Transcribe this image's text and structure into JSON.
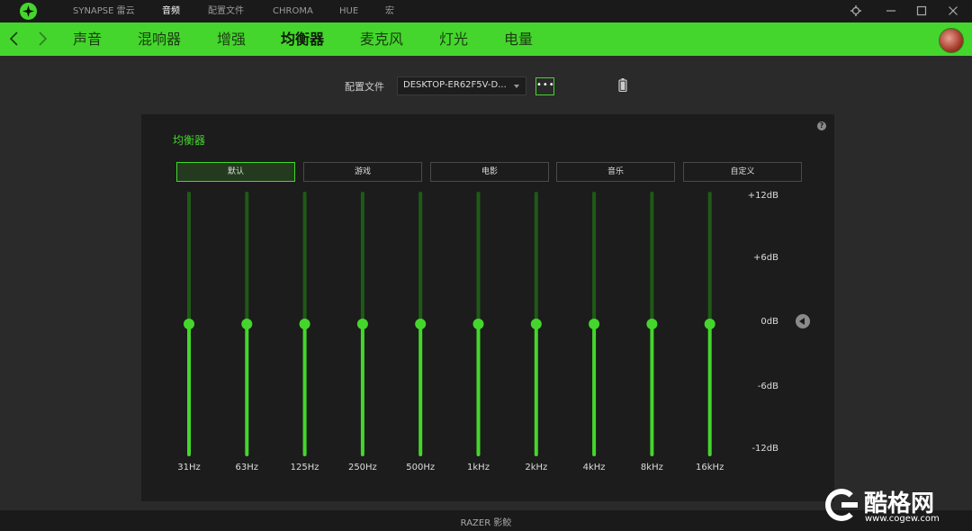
{
  "titlebar": {
    "nav": [
      "SYNAPSE 雷云",
      "音频",
      "配置文件",
      "CHROMA",
      "HUE",
      "宏"
    ],
    "active_index": 1
  },
  "subnav": {
    "items": [
      "声音",
      "混响器",
      "增强",
      "均衡器",
      "麦克风",
      "灯光",
      "电量"
    ],
    "active_index": 3
  },
  "profile": {
    "label": "配置文件",
    "value": "DESKTOP-ER62F5V-D...",
    "more_label": "•••"
  },
  "equalizer": {
    "title": "均衡器",
    "help": "?",
    "presets": [
      "默认",
      "游戏",
      "电影",
      "音乐",
      "自定义"
    ],
    "active_preset": 0,
    "db_scale": [
      "+12dB",
      "+6dB",
      "0dB",
      "-6dB",
      "-12dB"
    ],
    "db_range": [
      -12,
      12
    ],
    "bands": [
      {
        "freq": "31Hz",
        "gain_db": 0
      },
      {
        "freq": "63Hz",
        "gain_db": 0
      },
      {
        "freq": "125Hz",
        "gain_db": 0
      },
      {
        "freq": "250Hz",
        "gain_db": 0
      },
      {
        "freq": "500Hz",
        "gain_db": 0
      },
      {
        "freq": "1kHz",
        "gain_db": 0
      },
      {
        "freq": "2kHz",
        "gain_db": 0
      },
      {
        "freq": "4kHz",
        "gain_db": 0
      },
      {
        "freq": "8kHz",
        "gain_db": 0
      },
      {
        "freq": "16kHz",
        "gain_db": 0
      }
    ]
  },
  "statusbar": {
    "text": "RAZER 影鲛"
  },
  "watermark": {
    "text": "酷格网",
    "url": "www.cogew.com"
  },
  "colors": {
    "accent": "#44d62c",
    "track_dim": "#1f5a17"
  }
}
